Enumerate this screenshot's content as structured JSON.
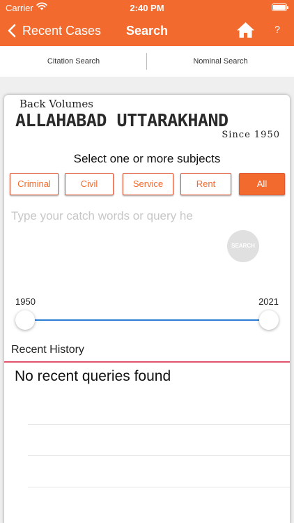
{
  "status": {
    "carrier": "Carrier",
    "time": "2:40 PM",
    "battery_level": 1.0
  },
  "nav": {
    "back_label": "Recent Cases",
    "title": "Search",
    "help_label": "?"
  },
  "tabs": [
    {
      "label": "Citation Search"
    },
    {
      "label": "Nominal Search"
    }
  ],
  "logo": {
    "top_text": "Back Volumes",
    "main_text": "ALLAHABAD UTTARAKHAND",
    "since_text": "Since 1950"
  },
  "subjects": {
    "prompt": "Select one or more subjects",
    "options": [
      {
        "label": "Criminal",
        "selected": false
      },
      {
        "label": "Civil",
        "selected": false
      },
      {
        "label": "Service",
        "selected": false
      },
      {
        "label": "Rent",
        "selected": false
      },
      {
        "label": "All",
        "selected": true
      }
    ]
  },
  "query": {
    "value": "",
    "placeholder": "Type your catch words or query he"
  },
  "search_button": {
    "label": "SEARCH"
  },
  "year_range": {
    "min_label": "1950",
    "max_label": "2021",
    "selected_from": 1950,
    "selected_to": 2021
  },
  "history": {
    "heading": "Recent History",
    "empty_message": "No recent queries found"
  },
  "colors": {
    "accent": "#f26a2e",
    "slider_track": "#2a7dd1",
    "history_rule": "#e0536a",
    "search_button_bg": "#e0e0e0"
  },
  "icons": [
    "wifi-icon",
    "battery-icon",
    "back-chevron-icon",
    "home-icon"
  ]
}
